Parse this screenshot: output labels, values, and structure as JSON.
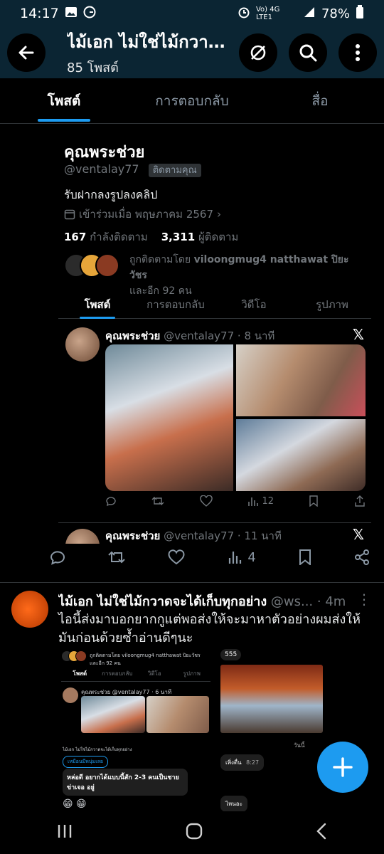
{
  "status_bar": {
    "time": "14:17",
    "signal_text": "Vo) 4G LTE1",
    "battery": "78%"
  },
  "header": {
    "title": "ไม้เอก ไม่ใช่ไม้กวาดจ...",
    "subtitle": "85 โพสต์"
  },
  "tabs": [
    {
      "label": "โพสต์"
    },
    {
      "label": "การตอบกลับ"
    },
    {
      "label": "สื่อ"
    }
  ],
  "quoted_profile": {
    "name": "คุณพระช่วย",
    "handle": "@ventalay77",
    "follows_you": "ติดตามคุณ",
    "bio": "รับฝากลงรูปลงคลิป",
    "joined": "เข้าร่วมเมื่อ พฤษภาคม 2567",
    "following_count": "167",
    "following_label": "กำลังติดตาม",
    "followers_count": "3,311",
    "followers_label": "ผู้ติดตาม",
    "followed_by_prefix": "ถูกติดตามโดย",
    "followed_by_names": "viloongmug4 natthawat ปิยะวัชร",
    "followed_by_suffix": "และอีก 92 คน",
    "tabs": [
      {
        "label": "โพสต์"
      },
      {
        "label": "การตอบกลับ"
      },
      {
        "label": "วิดีโอ"
      },
      {
        "label": "รูปภาพ"
      }
    ],
    "tweet1": {
      "name": "คุณพระช่วย",
      "meta": "@ventalay77 · 8 นาที",
      "views": "12"
    },
    "tweet2": {
      "name": "คุณพระช่วย",
      "meta": "@ventalay77 · 11 นาที"
    }
  },
  "outer_actions": {
    "views": "4"
  },
  "main_tweet": {
    "name": "ไม้เอก ไม่ใช่ไม้กวาดจะได้เก็บทุกอย่าง",
    "meta": "@ws... · 4m",
    "text": "ไอนี้ส่งมาบอกยากกูแต่พอส่งให้จะมาหาตัวอย่างผมส่งให้มันก่อนด้วยซ้ำอ่านดีๆนะ",
    "media": {
      "mini_followed": "ถูกติดตามโดย viloongmug4 natthawat ปิยะวัชร และอีก 92 คน",
      "mini_tabs": [
        "โพสต์",
        "การตอบกลับ",
        "วิดีโอ",
        "รูปภาพ"
      ],
      "mini_tweet_head": "คุณพระช่วย @ventalay77 · 6 นาที",
      "mini_line1": "ไม้เอก ไม่ใช่ไม้กวาดจะได้เก็บทุกอย่าง",
      "mini_chip": "เหมือนมีหนุ่มเลย",
      "mini_bubble1": "หล่อดี อยากได้แบบนี้สัก 2-3 คนเป็นชายข่าเจอ อยู่",
      "mini_emoji": "😁 😁",
      "chat_badge": "555",
      "chat_time": "วันนี้",
      "chat_bubble1": "เพิ่งตื่น",
      "chat_bubble1_time": "8:27",
      "chat_bubble2": "ไหนอะ"
    }
  },
  "colors": {
    "accent": "#1d9bf0",
    "header_bg": "#0b2533",
    "background": "#000000",
    "muted": "#71767b"
  }
}
